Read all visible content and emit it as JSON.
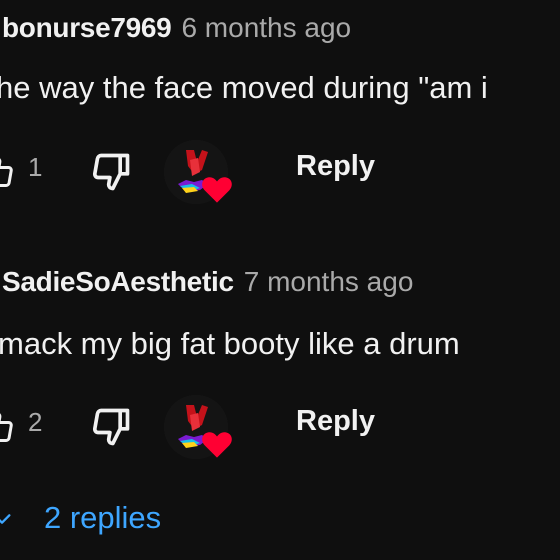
{
  "comments": [
    {
      "author": "bonurse7969",
      "time": "6 months ago",
      "text": "he way the face moved during \"am i",
      "likes": "1",
      "reply_label": "Reply",
      "creator_heart": true
    },
    {
      "author": "SadieSoAesthetic",
      "time": "7 months ago",
      "text": "mack my big fat booty like a drum",
      "likes": "2",
      "reply_label": "Reply",
      "creator_heart": true
    }
  ],
  "replies_toggle": {
    "label": "2 replies",
    "icon": "chevron-down-icon"
  },
  "colors": {
    "background": "#0f0f0f",
    "text": "#f1f1f1",
    "secondary": "#aaaaaa",
    "link": "#3ea6ff",
    "heart": "#ff0033"
  },
  "icons": {
    "like": "thumb-up-icon",
    "dislike": "thumb-down-icon",
    "heart": "creator-heart-icon"
  }
}
